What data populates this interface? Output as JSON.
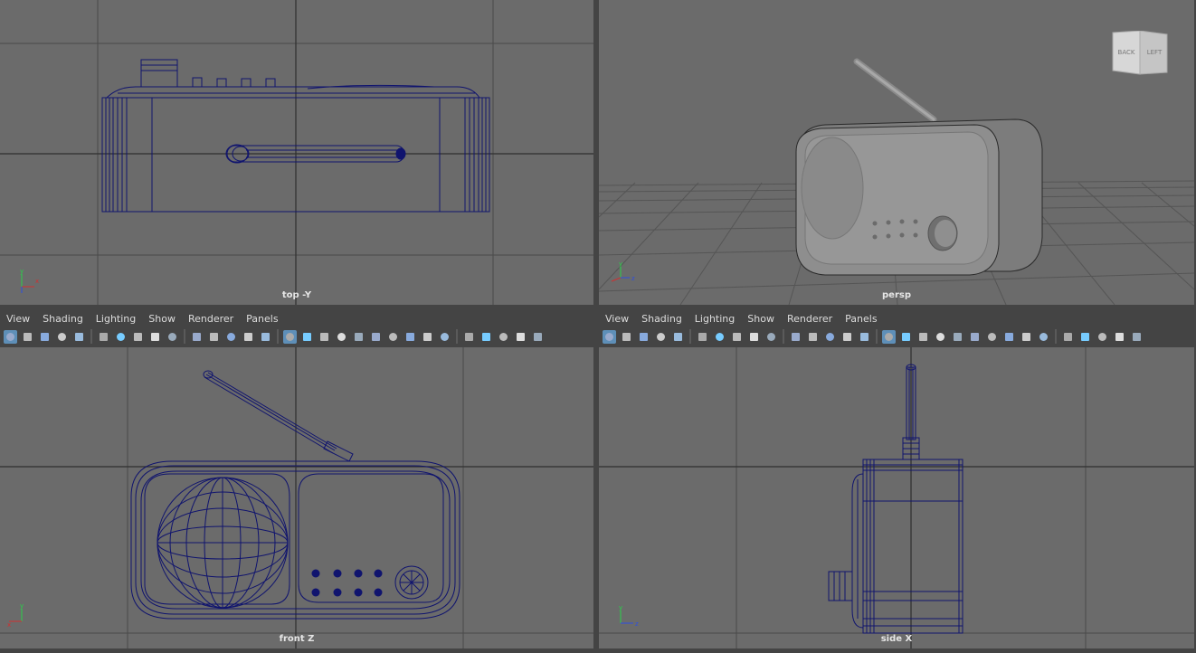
{
  "panels": {
    "top": {
      "camera_label": "top -Y",
      "axis": {
        "a": "y",
        "b": "x"
      }
    },
    "persp": {
      "camera_label": "persp",
      "axis": {
        "a": "y",
        "b": "z"
      }
    },
    "front": {
      "camera_label": "front Z",
      "axis": {
        "a": "y",
        "b": "x"
      }
    },
    "side": {
      "camera_label": "side X",
      "axis": {
        "a": "y",
        "b": "z"
      }
    }
  },
  "menus": {
    "left": [
      "View",
      "Shading",
      "Lighting",
      "Show",
      "Renderer",
      "Panels"
    ],
    "right": [
      "View",
      "Shading",
      "Lighting",
      "Show",
      "Renderer",
      "Panels"
    ]
  },
  "viewcube": {
    "back": "BACK",
    "left": "LEFT"
  },
  "colors": {
    "viewport_bg": "#6b6b6b",
    "wireframe": "#10146e",
    "grid": "#4a4a4a",
    "toolbar_active": "#5e8fb8"
  },
  "toolbar_icons": [
    "select-camera-icon",
    "camera-attributes-icon",
    "bookmark-icon",
    "image-plane-icon",
    "grease-pencil-icon",
    "camera-icon",
    "lock-camera-icon",
    "2d-pan-zoom-icon",
    "film-gate-icon",
    "resolution-gate-icon",
    "grid-icon",
    "field-chart-icon",
    "safe-action-icon",
    "safe-title-icon",
    "pencil-icon",
    "wireframe-icon",
    "smooth-shade-icon",
    "bounding-box-icon",
    "textured-icon",
    "shaded-wire-icon",
    "lights-icon",
    "shadows-icon",
    "ambient-occlusion-icon",
    "motion-blur-icon",
    "anti-alias-icon",
    "depth-of-field-icon",
    "isolate-select-icon",
    "xray-icon",
    "xray-joints-icon",
    "backface-icon"
  ]
}
